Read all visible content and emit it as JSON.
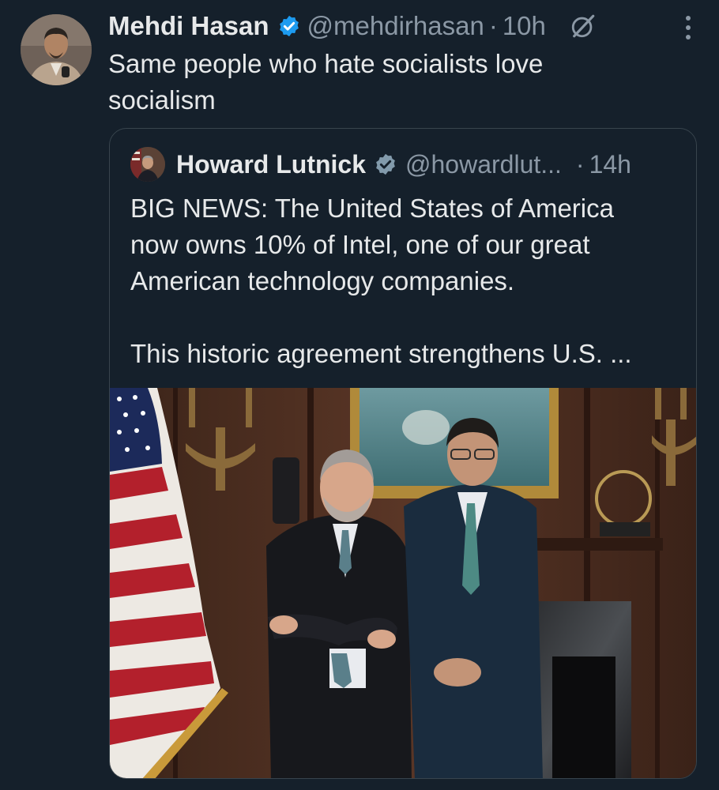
{
  "tweet": {
    "display_name": "Mehdi Hasan",
    "handle": "@mehdirhasan",
    "separator": "·",
    "time": "10h",
    "text_line1": "Same people who hate socialists love",
    "text_line2": "socialism",
    "icons": {
      "verified": "verified-badge-icon",
      "grok": "grok-icon",
      "more": "more-options-icon"
    }
  },
  "quote": {
    "display_name": "Howard Lutnick",
    "handle": "@howardlut...",
    "separator": "·",
    "time": "14h",
    "paragraph1_line1": "BIG NEWS: The United States of America",
    "paragraph1_line2": "now owns 10% of Intel, one of our great",
    "paragraph1_line3": "American technology companies.",
    "paragraph2": "This historic agreement strengthens U.S. ...",
    "icons": {
      "verified": "verified-badge-grey-icon"
    }
  },
  "colors": {
    "background": "#15202b",
    "text": "#e7e9ea",
    "secondary_text": "#8b98a5",
    "border": "#38444d",
    "verified_blue": "#1d9bf0"
  }
}
